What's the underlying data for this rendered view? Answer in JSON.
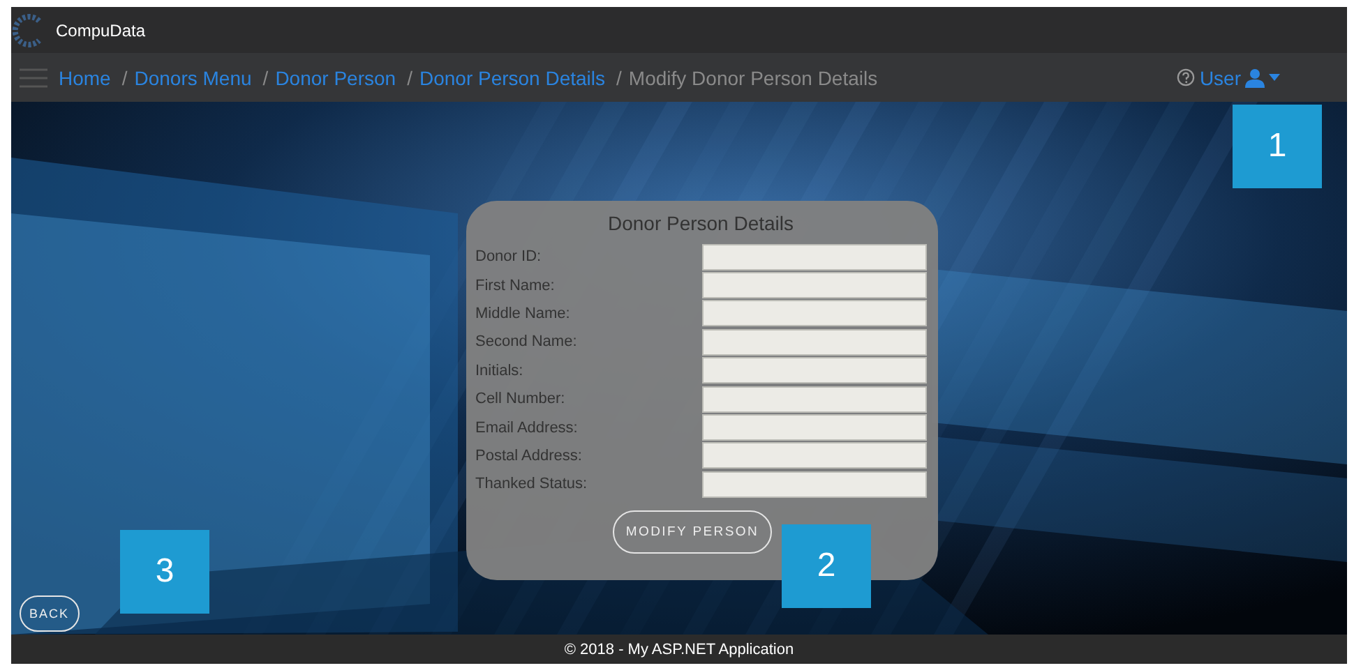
{
  "app": {
    "name": "CompuData"
  },
  "breadcrumb": {
    "separator": "/",
    "items": [
      {
        "label": "Home",
        "link": true
      },
      {
        "label": "Donors Menu",
        "link": true
      },
      {
        "label": "Donor Person",
        "link": true
      },
      {
        "label": "Donor Person Details",
        "link": true
      },
      {
        "label": "Modify Donor Person Details",
        "link": false
      }
    ]
  },
  "user_menu": {
    "label": "User"
  },
  "form": {
    "title": "Donor Person Details",
    "fields": [
      {
        "label": "Donor ID:"
      },
      {
        "label": "First Name:"
      },
      {
        "label": "Middle Name:"
      },
      {
        "label": "Second Name:"
      },
      {
        "label": "Initials:"
      },
      {
        "label": "Cell Number:"
      },
      {
        "label": "Email Address:"
      },
      {
        "label": "Postal Address:"
      },
      {
        "label": "Thanked Status:"
      }
    ],
    "submit": "MODIFY PERSON"
  },
  "back_button": "BACK",
  "callouts": [
    "1",
    "2",
    "3"
  ],
  "footer": "© 2018 - My ASP.NET Application"
}
